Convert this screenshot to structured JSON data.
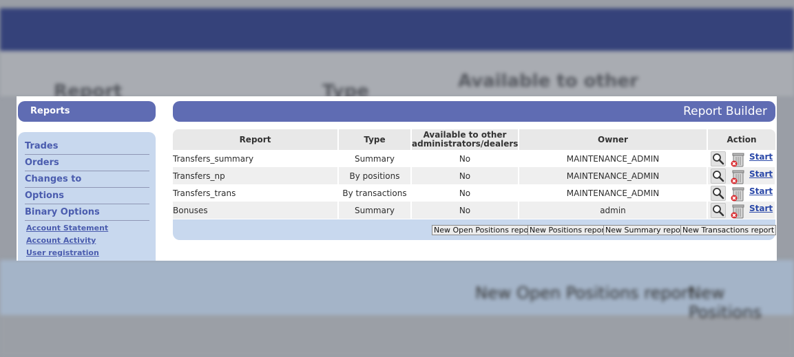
{
  "background": {
    "report_header": "Report",
    "type_header": "Type",
    "available_header": "Available to other",
    "btn_open_positions": "New Open Positions report",
    "btn_positions": "New Positions"
  },
  "sidebar": {
    "title": "Reports",
    "menu": [
      {
        "label": "Trades"
      },
      {
        "label": "Orders"
      },
      {
        "label": "Changes to"
      },
      {
        "label": "Options"
      },
      {
        "label": "Binary Options"
      }
    ],
    "links": [
      {
        "label": "Account Statement"
      },
      {
        "label": "Account Activity"
      },
      {
        "label": "User registration"
      }
    ]
  },
  "report_builder": {
    "title": "Report Builder",
    "columns": {
      "report": "Report",
      "type": "Type",
      "available_1": "Available to other",
      "available_2": "administrators/dealers",
      "owner": "Owner",
      "action": "Action"
    },
    "rows": [
      {
        "report": "Transfers_summary",
        "type": "Summary",
        "available": "No",
        "owner": "MAINTENANCE_ADMIN",
        "start": "Start"
      },
      {
        "report": "Transfers_np",
        "type": "By positions",
        "available": "No",
        "owner": "MAINTENANCE_ADMIN",
        "start": "Start"
      },
      {
        "report": "Transfers_trans",
        "type": "By transactions",
        "available": "No",
        "owner": "MAINTENANCE_ADMIN",
        "start": "Start"
      },
      {
        "report": "Bonuses",
        "type": "Summary",
        "available": "No",
        "owner": "admin",
        "start": "Start"
      }
    ],
    "buttons": {
      "open_positions": "New Open Positions report",
      "positions": "New Positions report",
      "summary": "New Summary report",
      "transactions": "New Transactions report"
    }
  },
  "colors": {
    "accent": "#5f6cb3",
    "sidebar_bg": "#c8d8ee",
    "link": "#4a5cae"
  },
  "icons": {
    "view": "magnifier-icon",
    "delete": "trash-delete-icon"
  }
}
